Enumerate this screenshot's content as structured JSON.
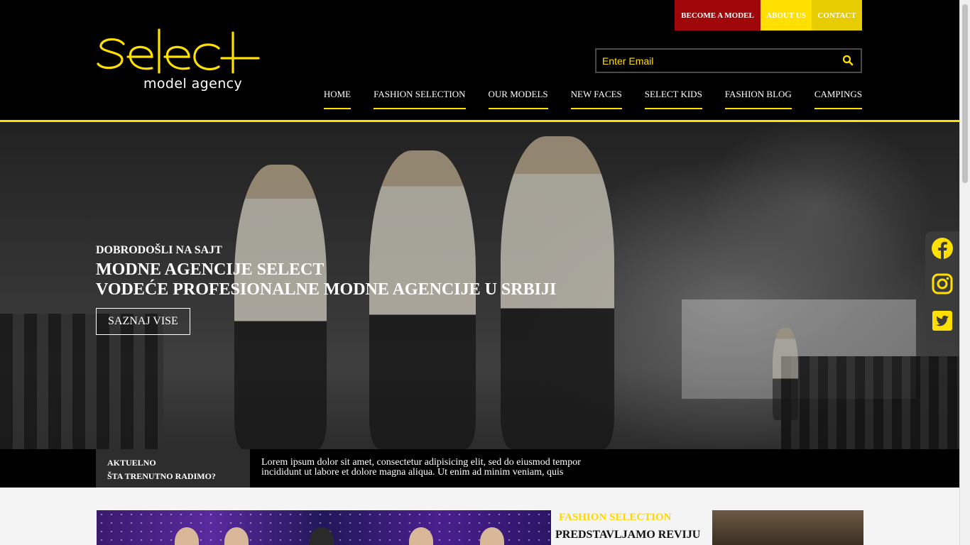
{
  "topbar": {
    "become_model": "BECOME A MODEL",
    "about_us": "ABOUT US",
    "contact": "CONTACT"
  },
  "logo": {
    "wordmark": "select",
    "tagline": "model agency"
  },
  "search": {
    "placeholder": "Enter Email"
  },
  "nav": [
    "HOME",
    "FASHION SELECTION",
    "OUR MODELS",
    "NEW FACES",
    "SELECT KIDS",
    "FASHION BLOG",
    "CAMPINGS"
  ],
  "hero": {
    "kicker": "DOBRODOŠLI NA SAJT",
    "title_line1": "MODNE AGENCIJE SELECT",
    "title_line2": "VODEĆE PROFESIONALNE MODNE AGENCIJE U SRBIJI",
    "button": "SAZNAJ VISE"
  },
  "social": [
    "facebook-icon",
    "instagram-icon",
    "twitter-icon"
  ],
  "strip": {
    "label_line1": "AKTUELNO",
    "label_line2": "ŠTA TRENUTNO RADIMO?",
    "text": "Lorem ipsum dolor sit amet, consectetur adipisicing elit, sed do eiusmod tempor incididunt ut labore et dolore magna aliqua. Ut enim ad minim veniam, quis"
  },
  "card": {
    "kicker": "FASHION SELECTION",
    "title": "PREDSTAVLJAMO REVIJU"
  },
  "colors": {
    "accent": "#ffe000",
    "become_model_bg": "#a0070a",
    "dark": "#000000"
  }
}
